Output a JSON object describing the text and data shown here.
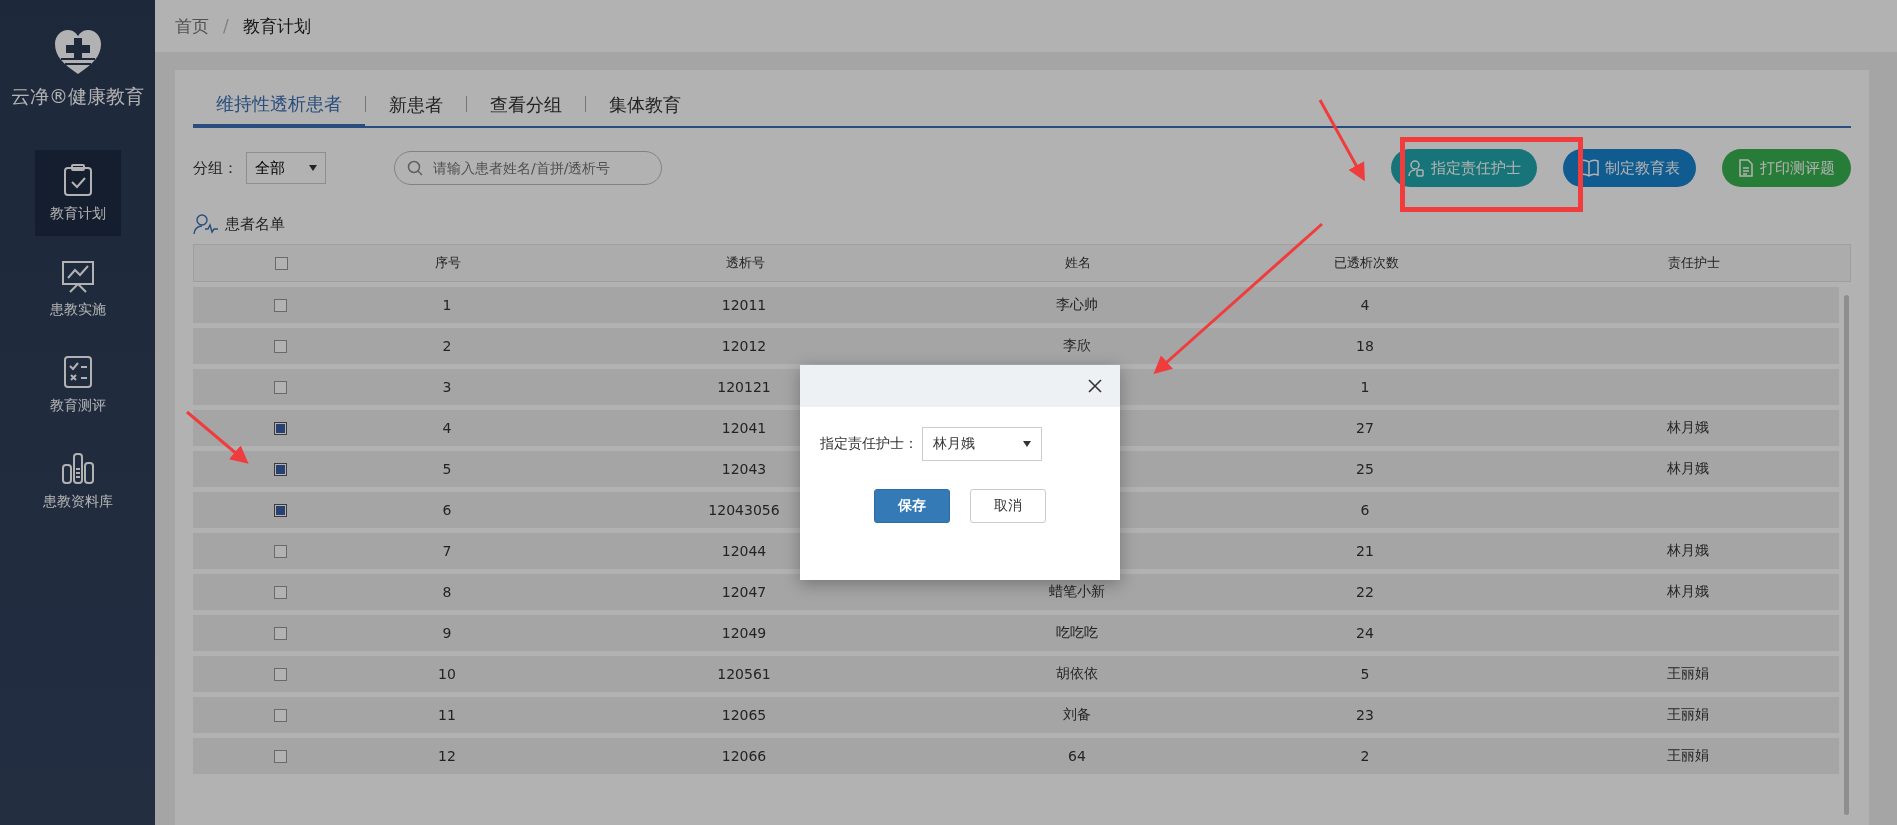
{
  "sidebar": {
    "brand": "云净®健康教育",
    "items": [
      {
        "label": "教育计划",
        "selected": true
      },
      {
        "label": "患教实施",
        "selected": false
      },
      {
        "label": "教育测评",
        "selected": false
      },
      {
        "label": "患教资料库",
        "selected": false
      }
    ]
  },
  "breadcrumb": [
    {
      "label": "首页"
    },
    {
      "label": "教育计划"
    }
  ],
  "breadcrumb_separator": "/",
  "tabs": [
    {
      "label": "维持性透析患者",
      "selected": true
    },
    {
      "label": "新患者",
      "selected": false
    },
    {
      "label": "查看分组",
      "selected": false
    },
    {
      "label": "集体教育",
      "selected": false
    }
  ],
  "filter": {
    "label": "分组：",
    "value": "全部",
    "search_placeholder": "请输入患者姓名/首拼/透析号"
  },
  "actions": [
    {
      "label": "指定责任护士"
    },
    {
      "label": "制定教育表"
    },
    {
      "label": "打印测评题"
    }
  ],
  "list_title": "患者名单",
  "table": {
    "header_checked": false,
    "columns": [
      "序号",
      "透析号",
      "姓名",
      "已透析次数",
      "责任护士"
    ],
    "rows": [
      {
        "checked": false,
        "cells": [
          "1",
          "12011",
          "李心帅",
          "4",
          ""
        ]
      },
      {
        "checked": false,
        "cells": [
          "2",
          "12012",
          "李欣",
          "18",
          ""
        ]
      },
      {
        "checked": false,
        "cells": [
          "3",
          "120121",
          "",
          "1",
          ""
        ]
      },
      {
        "checked": true,
        "cells": [
          "4",
          "12041",
          "",
          "27",
          "林月娥"
        ]
      },
      {
        "checked": true,
        "cells": [
          "5",
          "12043",
          "",
          "25",
          "林月娥"
        ]
      },
      {
        "checked": true,
        "cells": [
          "6",
          "12043056",
          "",
          "6",
          ""
        ]
      },
      {
        "checked": false,
        "cells": [
          "7",
          "12044",
          "",
          "21",
          "林月娥"
        ]
      },
      {
        "checked": false,
        "cells": [
          "8",
          "12047",
          "蜡笔小新",
          "22",
          "林月娥"
        ]
      },
      {
        "checked": false,
        "cells": [
          "9",
          "12049",
          "吃吃吃",
          "24",
          ""
        ]
      },
      {
        "checked": false,
        "cells": [
          "10",
          "120561",
          "胡依依",
          "5",
          "王丽娟"
        ]
      },
      {
        "checked": false,
        "cells": [
          "11",
          "12065",
          "刘备",
          "23",
          "王丽娟"
        ]
      },
      {
        "checked": false,
        "cells": [
          "12",
          "12066",
          "64",
          "2",
          "王丽娟"
        ]
      }
    ]
  },
  "dialog": {
    "field_label": "指定责任护士：",
    "field_value": "林月娥",
    "buttons": [
      {
        "label": "保存",
        "kind": "primary"
      },
      {
        "label": "取消",
        "kind": "default"
      }
    ]
  }
}
